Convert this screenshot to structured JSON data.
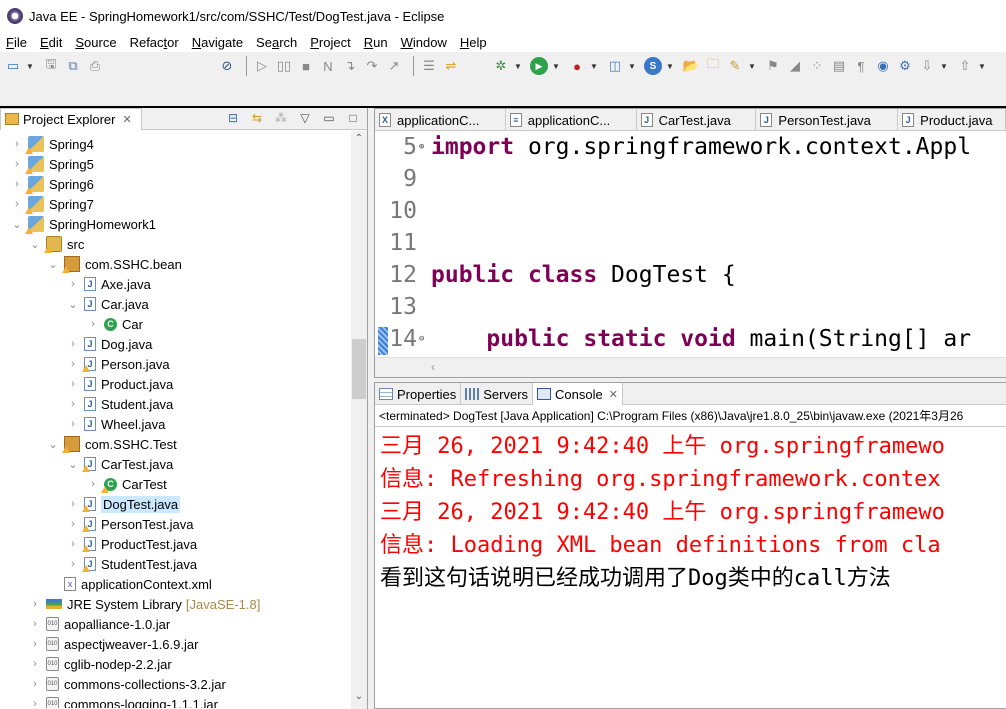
{
  "window": {
    "title": "Java EE - SpringHomework1/src/com/SSHC/Test/DogTest.java - Eclipse"
  },
  "menubar": {
    "items": [
      {
        "label": "File",
        "mnemonic": "F"
      },
      {
        "label": "Edit",
        "mnemonic": "E"
      },
      {
        "label": "Source",
        "mnemonic": "S"
      },
      {
        "label": "Refactor",
        "mnemonic": "t"
      },
      {
        "label": "Navigate",
        "mnemonic": "N"
      },
      {
        "label": "Search",
        "mnemonic": "a"
      },
      {
        "label": "Project",
        "mnemonic": "P"
      },
      {
        "label": "Run",
        "mnemonic": "R"
      },
      {
        "label": "Window",
        "mnemonic": "W"
      },
      {
        "label": "Help",
        "mnemonic": "H"
      }
    ]
  },
  "toolbar": {
    "icons": [
      "new-icon",
      "save-icon",
      "save-all-icon",
      "print-icon",
      "skip-breakpoints-icon",
      "resume-icon",
      "suspend-icon",
      "terminate-icon",
      "disconnect-icon",
      "step-into-icon",
      "step-over-icon",
      "step-return-icon",
      "drop-to-frame-icon",
      "use-step-filters-icon",
      "debug-icon",
      "run-icon",
      "run-external-tools-icon",
      "new-server-icon",
      "new-spring-bean-icon",
      "open-type-icon",
      "open-task-icon",
      "search-icon",
      "toggle-mark-occurrences-icon",
      "toggle-block-selection-icon",
      "show-whitespace-icon",
      "show-source-icon",
      "web-browser-icon",
      "deploy-icon",
      "next-annotation-icon",
      "previous-annotation-icon"
    ]
  },
  "explorer": {
    "tab_label": "Project Explorer",
    "close_glyph": "✕",
    "tree": [
      {
        "label": "Spring4",
        "depth": 0,
        "icon": "project",
        "expanded": false,
        "warning": true
      },
      {
        "label": "Spring5",
        "depth": 0,
        "icon": "project",
        "expanded": false,
        "warning": true
      },
      {
        "label": "Spring6",
        "depth": 0,
        "icon": "project",
        "expanded": false,
        "warning": true
      },
      {
        "label": "Spring7",
        "depth": 0,
        "icon": "project",
        "expanded": false,
        "warning": true
      },
      {
        "label": "SpringHomework1",
        "depth": 0,
        "icon": "project",
        "expanded": true,
        "warning": true
      },
      {
        "label": "src",
        "depth": 1,
        "icon": "src",
        "expanded": true,
        "warning": true
      },
      {
        "label": "com.SSHC.bean",
        "depth": 2,
        "icon": "package",
        "expanded": true,
        "warning": true
      },
      {
        "label": "Axe.java",
        "depth": 3,
        "icon": "java",
        "expanded": false,
        "warning": false
      },
      {
        "label": "Car.java",
        "depth": 3,
        "icon": "java",
        "expanded": true,
        "warning": false
      },
      {
        "label": "Car",
        "depth": 4,
        "icon": "class",
        "expanded": false,
        "warning": false
      },
      {
        "label": "Dog.java",
        "depth": 3,
        "icon": "java",
        "expanded": false,
        "warning": false
      },
      {
        "label": "Person.java",
        "depth": 3,
        "icon": "java",
        "expanded": false,
        "warning": true
      },
      {
        "label": "Product.java",
        "depth": 3,
        "icon": "java",
        "expanded": false,
        "warning": false
      },
      {
        "label": "Student.java",
        "depth": 3,
        "icon": "java",
        "expanded": false,
        "warning": false
      },
      {
        "label": "Wheel.java",
        "depth": 3,
        "icon": "java",
        "expanded": false,
        "warning": false
      },
      {
        "label": "com.SSHC.Test",
        "depth": 2,
        "icon": "package",
        "expanded": true,
        "warning": true
      },
      {
        "label": "CarTest.java",
        "depth": 3,
        "icon": "java",
        "expanded": true,
        "warning": true
      },
      {
        "label": "CarTest",
        "depth": 4,
        "icon": "class",
        "expanded": false,
        "warning": true
      },
      {
        "label": "DogTest.java",
        "depth": 3,
        "icon": "java",
        "expanded": false,
        "warning": true,
        "selected": true
      },
      {
        "label": "PersonTest.java",
        "depth": 3,
        "icon": "java",
        "expanded": false,
        "warning": true
      },
      {
        "label": "ProductTest.java",
        "depth": 3,
        "icon": "java",
        "expanded": false,
        "warning": true
      },
      {
        "label": "StudentTest.java",
        "depth": 3,
        "icon": "java",
        "expanded": false,
        "warning": true
      },
      {
        "label": "applicationContext.xml",
        "depth": 2,
        "icon": "xml",
        "leaf": true,
        "warning": false
      },
      {
        "label": "JRE System Library",
        "suffix": "[JavaSE-1.8]",
        "depth": 1,
        "icon": "library",
        "expanded": false,
        "warning": false
      },
      {
        "label": "aopalliance-1.0.jar",
        "depth": 1,
        "icon": "jar",
        "expanded": false,
        "warning": false
      },
      {
        "label": "aspectjweaver-1.6.9.jar",
        "depth": 1,
        "icon": "jar",
        "expanded": false,
        "warning": false
      },
      {
        "label": "cglib-nodep-2.2.jar",
        "depth": 1,
        "icon": "jar",
        "expanded": false,
        "warning": false
      },
      {
        "label": "commons-collections-3.2.jar",
        "depth": 1,
        "icon": "jar",
        "expanded": false,
        "warning": false
      },
      {
        "label": "commons-logging-1.1.1.jar",
        "depth": 1,
        "icon": "jar",
        "expanded": false,
        "warning": false
      }
    ]
  },
  "editor": {
    "tabs": [
      {
        "label": "applicationC...",
        "icon": "X"
      },
      {
        "label": "applicationC...",
        "icon": "≡"
      },
      {
        "label": "CarTest.java",
        "icon": "J"
      },
      {
        "label": "PersonTest.java",
        "icon": "J"
      },
      {
        "label": "Product.java",
        "icon": "J"
      }
    ],
    "lines": [
      {
        "num": "5",
        "fold": "⊕",
        "tokens": [
          {
            "t": "import",
            "k": "kw"
          },
          {
            "t": " org.springframework.context.Appl",
            "k": "plain"
          }
        ]
      },
      {
        "num": "9",
        "fold": "",
        "tokens": []
      },
      {
        "num": "10",
        "fold": "",
        "tokens": []
      },
      {
        "num": "11",
        "fold": "",
        "tokens": []
      },
      {
        "num": "12",
        "fold": "",
        "tokens": [
          {
            "t": "public",
            "k": "kw"
          },
          {
            "t": " ",
            "k": "plain"
          },
          {
            "t": "class",
            "k": "kw"
          },
          {
            "t": " DogTest {",
            "k": "plain"
          }
        ]
      },
      {
        "num": "13",
        "fold": "",
        "tokens": []
      },
      {
        "num": "14",
        "fold": "⊖",
        "tokens": [
          {
            "t": "    ",
            "k": "plain"
          },
          {
            "t": "public",
            "k": "kw"
          },
          {
            "t": " ",
            "k": "plain"
          },
          {
            "t": "static",
            "k": "kw"
          },
          {
            "t": " ",
            "k": "plain"
          },
          {
            "t": "void",
            "k": "kw"
          },
          {
            "t": " main(String[] ar",
            "k": "plain"
          }
        ]
      }
    ]
  },
  "console": {
    "tabs": [
      {
        "label": "Properties",
        "icon": "props",
        "active": false
      },
      {
        "label": "Servers",
        "icon": "servers",
        "active": false
      },
      {
        "label": "Console",
        "icon": "console",
        "active": true
      }
    ],
    "description": "<terminated> DogTest [Java Application] C:\\Program Files (x86)\\Java\\jre1.8.0_25\\bin\\javaw.exe (2021年3月26",
    "lines": [
      {
        "text": "三月 26, 2021 9:42:40 上午 org.springframewo",
        "stream": "err"
      },
      {
        "text": "信息: Refreshing org.springframework.contex",
        "stream": "err"
      },
      {
        "text": "三月 26, 2021 9:42:40 上午 org.springframewo",
        "stream": "err"
      },
      {
        "text": "信息: Loading XML bean definitions from cla",
        "stream": "err"
      },
      {
        "text": "看到这句话说明已经成功调用了Dog类中的call方法",
        "stream": "out"
      }
    ]
  },
  "colors": {
    "keyword": "#7f0055",
    "stderr": "#ff0000",
    "selection": "#cce8ff"
  }
}
